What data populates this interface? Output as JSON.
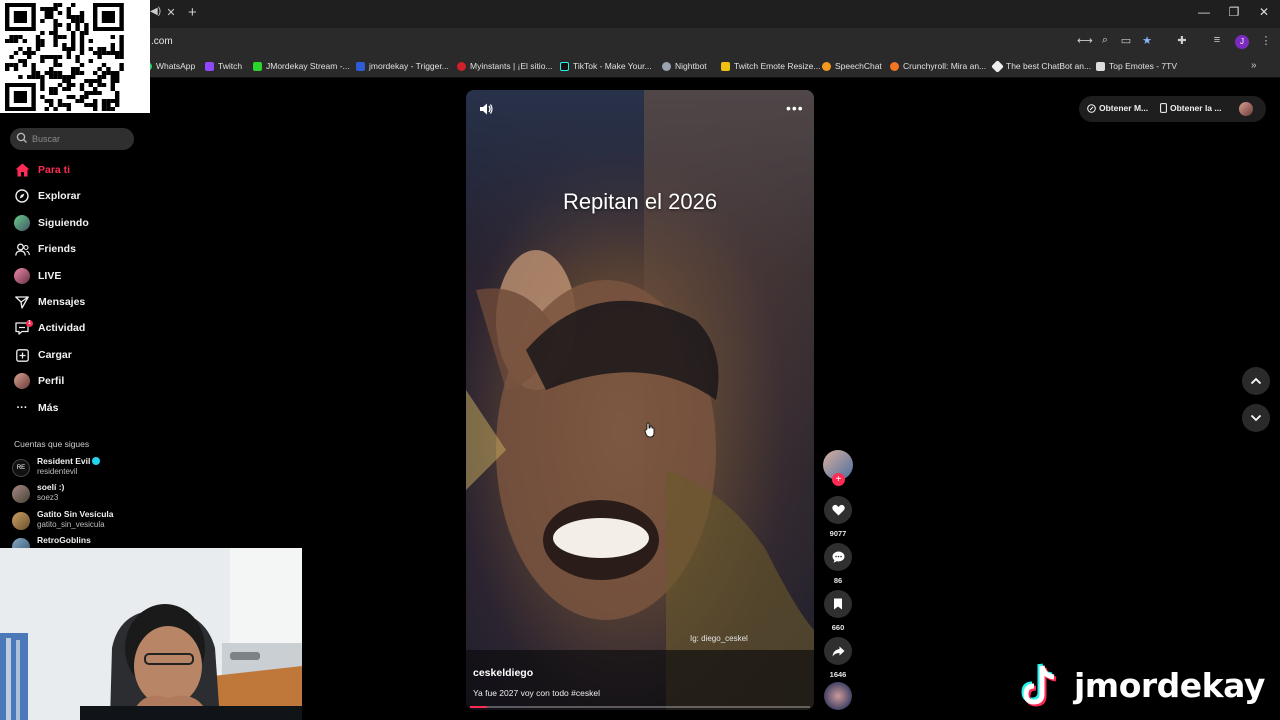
{
  "browser": {
    "url": ".com",
    "tab_close": "✕",
    "new_tab": "+",
    "window": {
      "minimize": "—",
      "restore": "❐",
      "close": "✕"
    }
  },
  "bookmarks": [
    {
      "label": "WhatsApp",
      "color": "#25d366"
    },
    {
      "label": "Twitch",
      "color": "#9146ff"
    },
    {
      "label": "JMordekay Stream -...",
      "color": "#2bd52b"
    },
    {
      "label": "jmordekay - Trigger...",
      "color": "#2f5bd6"
    },
    {
      "label": "Myinstants | ¡El sitio...",
      "color": "#d0202a"
    },
    {
      "label": "TikTok - Make Your...",
      "color": "#111111"
    },
    {
      "label": "Nightbot",
      "color": "#9aa3b0"
    },
    {
      "label": "Twitch Emote Resize...",
      "color": "#f0c010"
    },
    {
      "label": "SpeechChat",
      "color": "#f39a1c"
    },
    {
      "label": "Crunchyroll: Mira an...",
      "color": "#f47521"
    },
    {
      "label": "The best ChatBot an...",
      "color": "#eeeeee"
    },
    {
      "label": "Top Emotes - 7TV",
      "color": "#dddddd"
    }
  ],
  "bookmarks_more": "»",
  "profile_initial": "J",
  "sidebar": {
    "search_placeholder": "Buscar",
    "nav": [
      {
        "label": "Para ti",
        "icon": "home-icon",
        "active": true
      },
      {
        "label": "Explorar",
        "icon": "compass-icon"
      },
      {
        "label": "Siguiendo",
        "icon": "avatar"
      },
      {
        "label": "Friends",
        "icon": "friends-icon"
      },
      {
        "label": "LIVE",
        "icon": "avatar"
      },
      {
        "label": "Mensajes",
        "icon": "send-icon"
      },
      {
        "label": "Actividad",
        "icon": "activity-icon",
        "badge": "1"
      },
      {
        "label": "Cargar",
        "icon": "upload-icon"
      },
      {
        "label": "Perfil",
        "icon": "avatar"
      },
      {
        "label": "Más",
        "icon": "more-icon"
      }
    ],
    "following_header": "Cuentas que sigues",
    "following": [
      {
        "name": "Resident Evil",
        "user": "residentevil",
        "verified": true
      },
      {
        "name": "soelí :)",
        "user": "soez3",
        "verified": false
      },
      {
        "name": "Gatito Sin Vesícula",
        "user": "gatito_sin_vesicula",
        "verified": false
      },
      {
        "name": "RetroGoblins",
        "user": "",
        "verified": false
      }
    ]
  },
  "video": {
    "overlay_text": "Repitan el 2026",
    "watermark": "Ig: diego_ceskel",
    "author": "ceskeldiego",
    "caption": "Ya fue 2027 voy con todo #ceskel",
    "progress": 0.05
  },
  "actions": {
    "follow": "+",
    "likes": "9077",
    "comments": "86",
    "saves": "660",
    "shares": "1646"
  },
  "topright": {
    "get_app": "Obtener M...",
    "get_pc": "Obtener la ..."
  },
  "brand": {
    "name": "jmordekay"
  },
  "colors": {
    "accent": "#fe2c55",
    "teal": "#25f4ee"
  }
}
